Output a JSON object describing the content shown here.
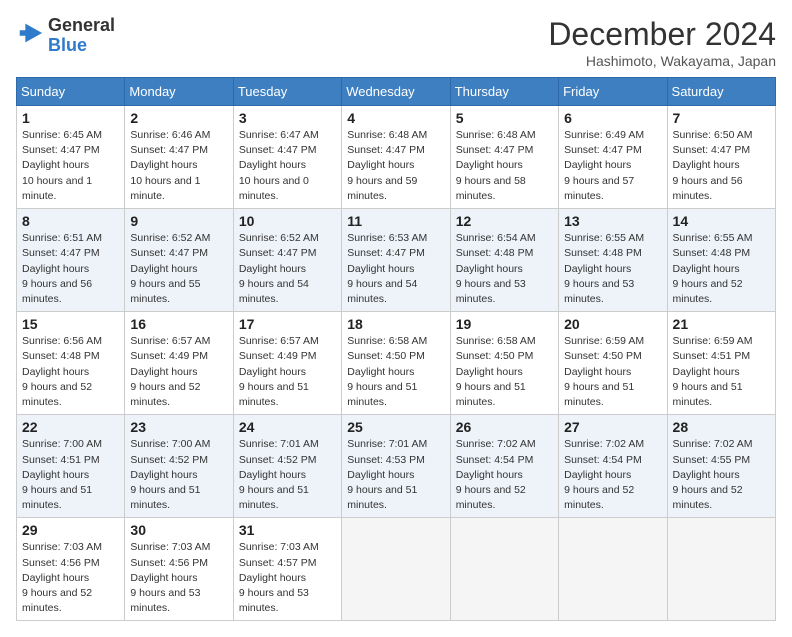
{
  "header": {
    "logo_line1": "General",
    "logo_line2": "Blue",
    "month": "December 2024",
    "location": "Hashimoto, Wakayama, Japan"
  },
  "weekdays": [
    "Sunday",
    "Monday",
    "Tuesday",
    "Wednesday",
    "Thursday",
    "Friday",
    "Saturday"
  ],
  "weeks": [
    [
      {
        "day": "1",
        "sunrise": "6:45 AM",
        "sunset": "4:47 PM",
        "daylight": "10 hours and 1 minute."
      },
      {
        "day": "2",
        "sunrise": "6:46 AM",
        "sunset": "4:47 PM",
        "daylight": "10 hours and 1 minute."
      },
      {
        "day": "3",
        "sunrise": "6:47 AM",
        "sunset": "4:47 PM",
        "daylight": "10 hours and 0 minutes."
      },
      {
        "day": "4",
        "sunrise": "6:48 AM",
        "sunset": "4:47 PM",
        "daylight": "9 hours and 59 minutes."
      },
      {
        "day": "5",
        "sunrise": "6:48 AM",
        "sunset": "4:47 PM",
        "daylight": "9 hours and 58 minutes."
      },
      {
        "day": "6",
        "sunrise": "6:49 AM",
        "sunset": "4:47 PM",
        "daylight": "9 hours and 57 minutes."
      },
      {
        "day": "7",
        "sunrise": "6:50 AM",
        "sunset": "4:47 PM",
        "daylight": "9 hours and 56 minutes."
      }
    ],
    [
      {
        "day": "8",
        "sunrise": "6:51 AM",
        "sunset": "4:47 PM",
        "daylight": "9 hours and 56 minutes."
      },
      {
        "day": "9",
        "sunrise": "6:52 AM",
        "sunset": "4:47 PM",
        "daylight": "9 hours and 55 minutes."
      },
      {
        "day": "10",
        "sunrise": "6:52 AM",
        "sunset": "4:47 PM",
        "daylight": "9 hours and 54 minutes."
      },
      {
        "day": "11",
        "sunrise": "6:53 AM",
        "sunset": "4:47 PM",
        "daylight": "9 hours and 54 minutes."
      },
      {
        "day": "12",
        "sunrise": "6:54 AM",
        "sunset": "4:48 PM",
        "daylight": "9 hours and 53 minutes."
      },
      {
        "day": "13",
        "sunrise": "6:55 AM",
        "sunset": "4:48 PM",
        "daylight": "9 hours and 53 minutes."
      },
      {
        "day": "14",
        "sunrise": "6:55 AM",
        "sunset": "4:48 PM",
        "daylight": "9 hours and 52 minutes."
      }
    ],
    [
      {
        "day": "15",
        "sunrise": "6:56 AM",
        "sunset": "4:48 PM",
        "daylight": "9 hours and 52 minutes."
      },
      {
        "day": "16",
        "sunrise": "6:57 AM",
        "sunset": "4:49 PM",
        "daylight": "9 hours and 52 minutes."
      },
      {
        "day": "17",
        "sunrise": "6:57 AM",
        "sunset": "4:49 PM",
        "daylight": "9 hours and 51 minutes."
      },
      {
        "day": "18",
        "sunrise": "6:58 AM",
        "sunset": "4:50 PM",
        "daylight": "9 hours and 51 minutes."
      },
      {
        "day": "19",
        "sunrise": "6:58 AM",
        "sunset": "4:50 PM",
        "daylight": "9 hours and 51 minutes."
      },
      {
        "day": "20",
        "sunrise": "6:59 AM",
        "sunset": "4:50 PM",
        "daylight": "9 hours and 51 minutes."
      },
      {
        "day": "21",
        "sunrise": "6:59 AM",
        "sunset": "4:51 PM",
        "daylight": "9 hours and 51 minutes."
      }
    ],
    [
      {
        "day": "22",
        "sunrise": "7:00 AM",
        "sunset": "4:51 PM",
        "daylight": "9 hours and 51 minutes."
      },
      {
        "day": "23",
        "sunrise": "7:00 AM",
        "sunset": "4:52 PM",
        "daylight": "9 hours and 51 minutes."
      },
      {
        "day": "24",
        "sunrise": "7:01 AM",
        "sunset": "4:52 PM",
        "daylight": "9 hours and 51 minutes."
      },
      {
        "day": "25",
        "sunrise": "7:01 AM",
        "sunset": "4:53 PM",
        "daylight": "9 hours and 51 minutes."
      },
      {
        "day": "26",
        "sunrise": "7:02 AM",
        "sunset": "4:54 PM",
        "daylight": "9 hours and 52 minutes."
      },
      {
        "day": "27",
        "sunrise": "7:02 AM",
        "sunset": "4:54 PM",
        "daylight": "9 hours and 52 minutes."
      },
      {
        "day": "28",
        "sunrise": "7:02 AM",
        "sunset": "4:55 PM",
        "daylight": "9 hours and 52 minutes."
      }
    ],
    [
      {
        "day": "29",
        "sunrise": "7:03 AM",
        "sunset": "4:56 PM",
        "daylight": "9 hours and 52 minutes."
      },
      {
        "day": "30",
        "sunrise": "7:03 AM",
        "sunset": "4:56 PM",
        "daylight": "9 hours and 53 minutes."
      },
      {
        "day": "31",
        "sunrise": "7:03 AM",
        "sunset": "4:57 PM",
        "daylight": "9 hours and 53 minutes."
      },
      null,
      null,
      null,
      null
    ]
  ]
}
